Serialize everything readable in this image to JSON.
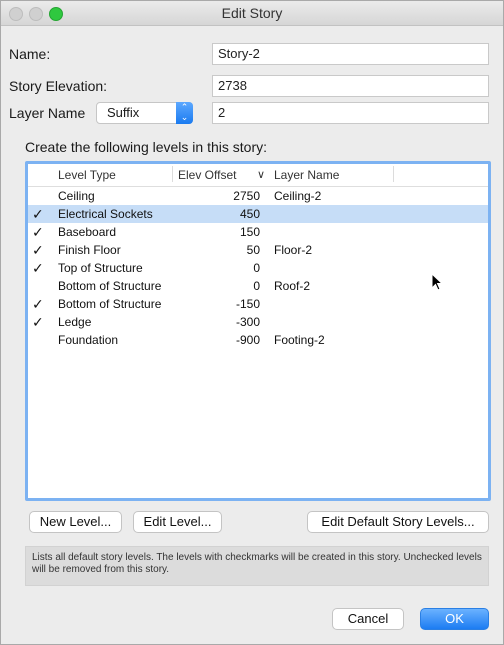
{
  "window": {
    "title": "Edit Story"
  },
  "form": {
    "name_label": "Name:",
    "name_value": "Story-2",
    "elevation_label": "Story Elevation:",
    "elevation_value": "2738",
    "layer_name_label": "Layer Name",
    "layer_name_mode": "Suffix",
    "layer_name_value": "2"
  },
  "levels": {
    "caption": "Create the following levels in this story:",
    "columns": {
      "type": "Level Type",
      "offset": "Elev Offset",
      "sort_arrow": "∨",
      "layer": "Layer Name"
    },
    "rows": [
      {
        "checked": false,
        "selected": false,
        "type": "Ceiling",
        "offset": "2750",
        "layer": "Ceiling-2"
      },
      {
        "checked": true,
        "selected": true,
        "type": "Electrical Sockets",
        "offset": "450",
        "layer": ""
      },
      {
        "checked": true,
        "selected": false,
        "type": "Baseboard",
        "offset": "150",
        "layer": ""
      },
      {
        "checked": true,
        "selected": false,
        "type": "Finish Floor",
        "offset": "50",
        "layer": "Floor-2"
      },
      {
        "checked": true,
        "selected": false,
        "type": "Top of Structure",
        "offset": "0",
        "layer": ""
      },
      {
        "checked": false,
        "selected": false,
        "type": "Bottom of Structure",
        "offset": "0",
        "layer": "Roof-2"
      },
      {
        "checked": true,
        "selected": false,
        "type": "Bottom of Structure",
        "offset": "-150",
        "layer": ""
      },
      {
        "checked": true,
        "selected": false,
        "type": "Ledge",
        "offset": "-300",
        "layer": ""
      },
      {
        "checked": false,
        "selected": false,
        "type": "Foundation",
        "offset": "-900",
        "layer": "Footing-2"
      }
    ]
  },
  "buttons": {
    "new_level": "New Level...",
    "edit_level": "Edit Level...",
    "edit_default": "Edit Default Story Levels...",
    "cancel": "Cancel",
    "ok": "OK"
  },
  "help_text": "Lists all default story levels. The levels with checkmarks will be created in this story. Unchecked levels will be removed from this story.",
  "colors": {
    "accent": "#1c7cf2",
    "selection": "#c6ddf7",
    "focus_ring": "#7cb2f2"
  },
  "icons": {
    "check": "✓",
    "popup_arrows": "updown-chevron-icon",
    "cursor": "arrow-cursor-icon"
  }
}
